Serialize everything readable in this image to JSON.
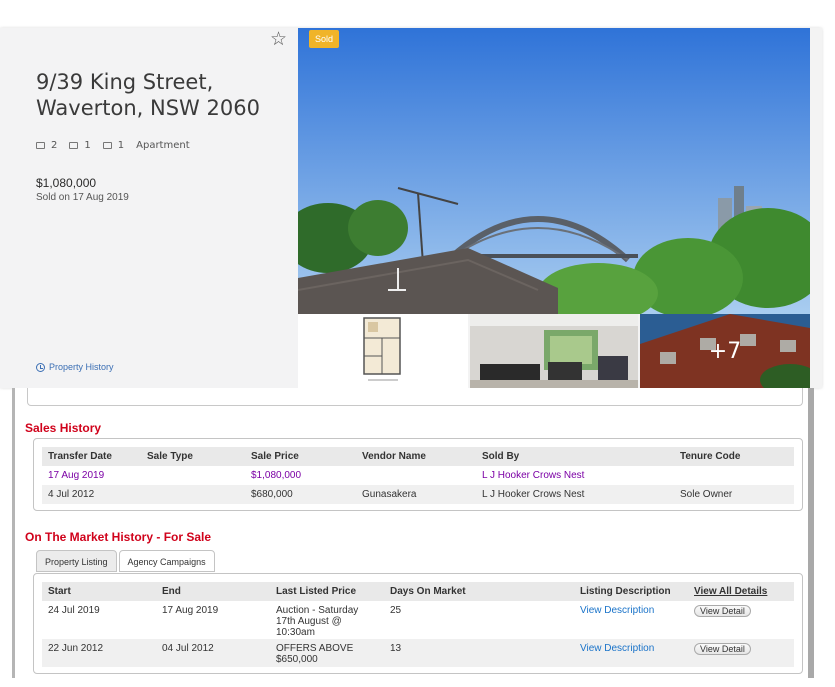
{
  "listing": {
    "address_line1": "9/39 King Street,",
    "address_line2": "Waverton, NSW 2060",
    "beds": "2",
    "baths": "1",
    "cars": "1",
    "property_type": "Apartment",
    "price": "$1,080,000",
    "sold_on": "Sold on 17 Aug 2019",
    "property_history_link": "Property History",
    "sold_badge": "Sold",
    "more_photos": "+7",
    "star_icon": "star-icon"
  },
  "sales_history": {
    "title": "Sales History",
    "columns": [
      "Transfer Date",
      "Sale Type",
      "Sale Price",
      "Vendor Name",
      "Sold By",
      "Tenure Code"
    ],
    "rows": [
      [
        "17 Aug 2019",
        "",
        "$1,080,000",
        "",
        "L J Hooker Crows Nest",
        ""
      ],
      [
        "4 Jul 2012",
        "",
        "$680,000",
        "Gunasakera",
        "L J Hooker Crows Nest",
        "Sole Owner"
      ]
    ]
  },
  "market_history": {
    "title": "On The Market History - For Sale",
    "tabs": [
      "Property Listing",
      "Agency Campaigns"
    ],
    "columns": [
      "Start",
      "End",
      "Last Listed Price",
      "Days On Market",
      "Listing Description",
      "View All Details"
    ],
    "rows": [
      {
        "start": "24 Jul 2019",
        "end": "17 Aug 2019",
        "price_l1": "Auction - Saturday",
        "price_l2": "17th August @",
        "price_l3": "10:30am",
        "days": "25",
        "desc": "View Description",
        "btn": "View Detail"
      },
      {
        "start": "22 Jun 2012",
        "end": "04 Jul 2012",
        "price_l1": "OFFERS ABOVE",
        "price_l2": "$650,000",
        "price_l3": "",
        "days": "13",
        "desc": "View Description",
        "btn": "View Detail"
      }
    ]
  },
  "colors": {
    "accent_red": "#d0021b",
    "link_blue": "#1a73c9",
    "highlight_purple": "#7b00a5",
    "sold_badge": "#f0b429"
  }
}
